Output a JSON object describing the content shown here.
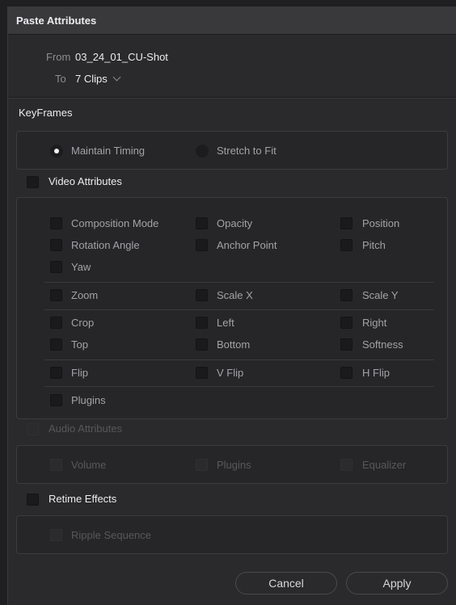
{
  "dialog": {
    "title": "Paste Attributes",
    "from_label": "From",
    "from_value": "03_24_01_CU-Shot",
    "to_label": "To",
    "to_value": "7 Clips"
  },
  "keyframes": {
    "heading": "KeyFrames",
    "maintain_timing": "Maintain Timing",
    "stretch_to_fit": "Stretch to Fit",
    "selected": "Maintain Timing"
  },
  "video": {
    "heading": "Video Attributes",
    "composition_mode": "Composition Mode",
    "opacity": "Opacity",
    "position": "Position",
    "rotation_angle": "Rotation Angle",
    "anchor_point": "Anchor Point",
    "pitch": "Pitch",
    "yaw": "Yaw",
    "zoom": "Zoom",
    "scale_x": "Scale X",
    "scale_y": "Scale Y",
    "crop": "Crop",
    "left": "Left",
    "right": "Right",
    "top": "Top",
    "bottom": "Bottom",
    "softness": "Softness",
    "flip": "Flip",
    "v_flip": "V Flip",
    "h_flip": "H Flip",
    "plugins": "Plugins"
  },
  "audio": {
    "heading": "Audio Attributes",
    "volume": "Volume",
    "plugins": "Plugins",
    "equalizer": "Equalizer"
  },
  "retime": {
    "heading": "Retime Effects",
    "ripple_sequence": "Ripple Sequence"
  },
  "buttons": {
    "cancel": "Cancel",
    "apply": "Apply"
  }
}
